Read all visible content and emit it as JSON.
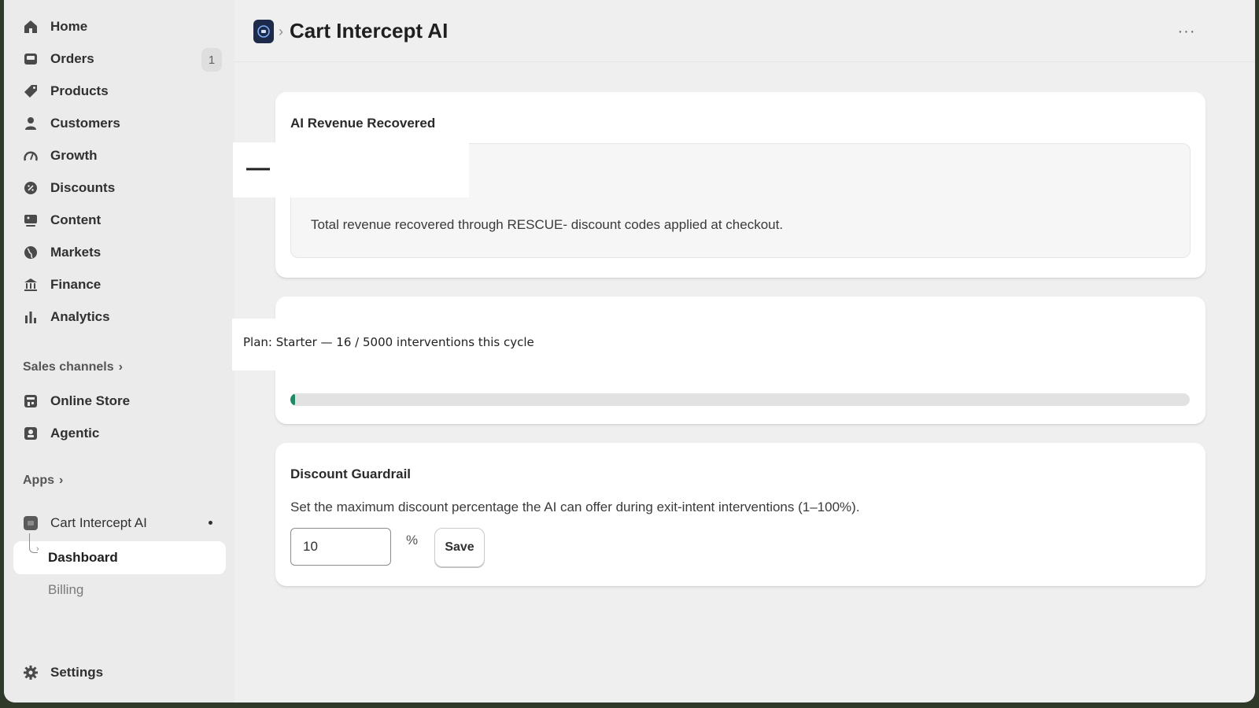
{
  "sidebar": {
    "items": [
      {
        "label": "Home",
        "icon": "home-icon"
      },
      {
        "label": "Orders",
        "icon": "inbox-icon",
        "badge": "1"
      },
      {
        "label": "Products",
        "icon": "tag-icon"
      },
      {
        "label": "Customers",
        "icon": "person-icon"
      },
      {
        "label": "Growth",
        "icon": "gauge-icon"
      },
      {
        "label": "Discounts",
        "icon": "discount-icon"
      },
      {
        "label": "Content",
        "icon": "content-icon"
      },
      {
        "label": "Markets",
        "icon": "globe-icon"
      },
      {
        "label": "Finance",
        "icon": "bank-icon"
      },
      {
        "label": "Analytics",
        "icon": "bar-chart-icon"
      }
    ],
    "sales_channels": {
      "heading": "Sales channels",
      "items": [
        {
          "label": "Online Store",
          "icon": "store-icon"
        },
        {
          "label": "Agentic",
          "icon": "agent-icon"
        }
      ]
    },
    "apps": {
      "heading": "Apps",
      "app_name": "Cart Intercept AI",
      "sub_items": [
        "Dashboard",
        "Billing"
      ]
    },
    "settings_label": "Settings"
  },
  "header": {
    "title": "Cart Intercept AI",
    "separator": "›",
    "more": "···"
  },
  "revenue_card": {
    "title": "AI Revenue Recovered",
    "value": "—",
    "description": "Total revenue recovered through RESCUE- discount codes applied at checkout."
  },
  "plan_card": {
    "text": "Plan: Starter — 16 / 5000 interventions this cycle",
    "used": 16,
    "limit": 5000
  },
  "guardrail_card": {
    "title": "Discount Guardrail",
    "description": "Set the maximum discount percentage the AI can offer during exit-intent interventions (1–100%).",
    "input_value": "10",
    "unit": "%",
    "save_label": "Save"
  },
  "colors": {
    "accent": "#1f8a64",
    "sidebar_bg": "#ebebeb",
    "page_bg": "#efefef"
  }
}
